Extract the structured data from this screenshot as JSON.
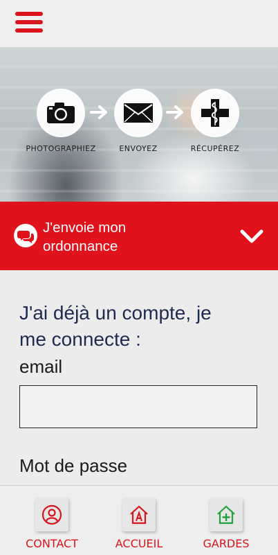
{
  "app": {
    "accent": "#e0121b",
    "guard_color": "#1fa33a"
  },
  "header": {
    "menu_icon": "hamburger-menu-icon"
  },
  "hero": {
    "steps": [
      {
        "label": "PHOTOGRAPHIEZ",
        "icon": "camera-icon"
      },
      {
        "label": "ENVOYEZ",
        "icon": "envelope-icon"
      },
      {
        "label": "RÉCUPÉREZ",
        "icon": "pharmacy-cross-icon"
      }
    ]
  },
  "banner": {
    "line1": "J'envoie mon",
    "line2": "ordonnance",
    "icon": "chat-bubble-icon"
  },
  "login": {
    "title_line1": "J'ai déjà un compte, je",
    "title_line2": "me connecte :",
    "email_label": "email",
    "email_value": "",
    "password_label": "Mot de passe"
  },
  "bottom_nav": [
    {
      "label": "CONTACT",
      "icon": "person-icon",
      "color": "#d9141c"
    },
    {
      "label": "ACCUEIL",
      "icon": "home-icon",
      "color": "#d9141c"
    },
    {
      "label": "GARDES",
      "icon": "house-plus-icon",
      "color": "#1fa33a"
    }
  ]
}
